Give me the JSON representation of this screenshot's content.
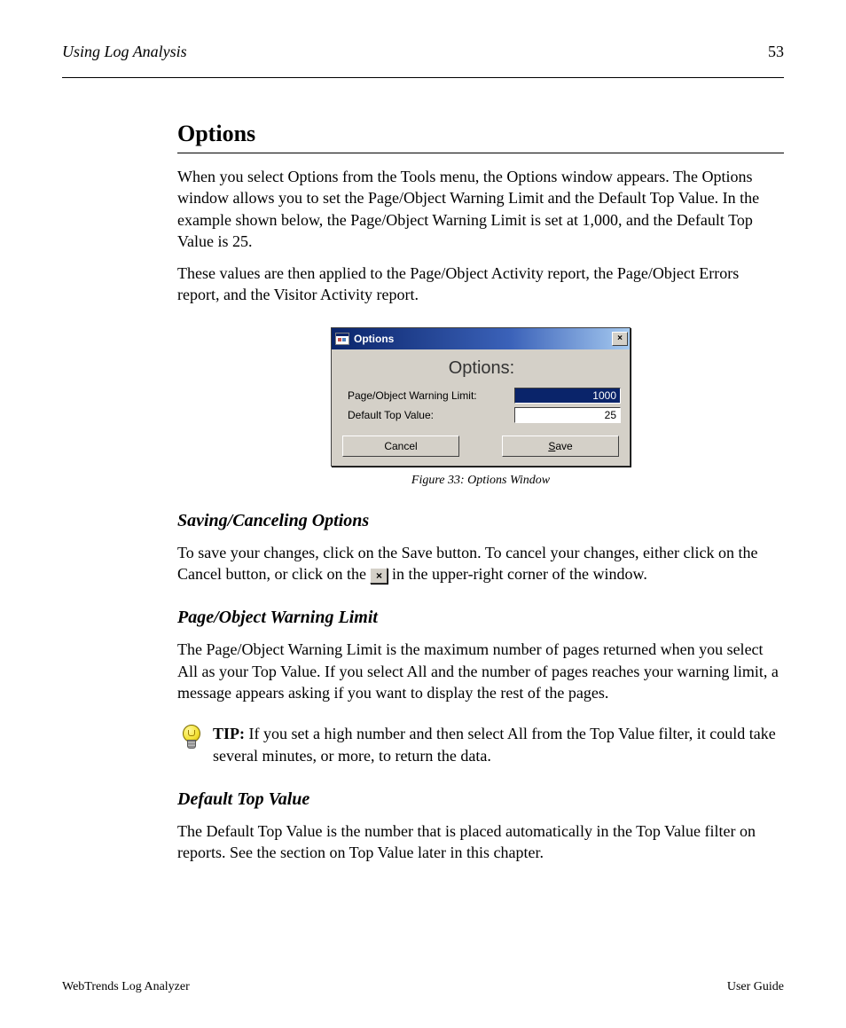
{
  "header": {
    "left": "Using Log Analysis",
    "right": "53"
  },
  "section": {
    "heading": "Options"
  },
  "intro": {
    "p1": "When you select Options from the Tools menu, the Options window appears. The Options window allows you to set the Page/Object Warning Limit and the Default Top Value. In the example shown below, the Page/Object Warning Limit is set at 1,000, and the Default Top Value is 25.",
    "p2": "These values are then applied to the Page/Object Activity report, the Page/Object Errors report, and the Visitor Activity report."
  },
  "dialog": {
    "title": "Options",
    "body_title": "Options:",
    "fields": {
      "warn_label": "Page/Object Warning Limit:",
      "warn_value": "1000",
      "top_label": "Default Top Value:",
      "top_value": "25"
    },
    "buttons": {
      "cancel": "Cancel",
      "save_pre": "S",
      "save_post": "ave"
    },
    "close_glyph": "×"
  },
  "figure_caption": "Figure 33: Options Window",
  "sub_save": {
    "heading": "Saving/Canceling Options",
    "p_before_icon": "To save your changes, click on the Save button. To cancel your changes, either click on the Cancel button, or click on the ",
    "p_after_icon": " in the upper-right corner of the window."
  },
  "sub_warn": {
    "heading": "Page/Object Warning Limit",
    "p1": "The Page/Object Warning Limit is the maximum number of pages returned when you select All as your Top Value. If you select All and the number of pages reaches your warning limit, a message appears asking if you want to display the rest of the pages.",
    "tip_label": "TIP:",
    "tip_body": " If you set a high number and then select All from the Top Value filter, it could take several minutes, or more, to return the data."
  },
  "sub_top": {
    "heading": "Default Top Value",
    "p1": "The Default Top Value is the number that is placed automatically in the Top Value filter on reports. See the section on Top Value later in this chapter."
  },
  "footer": {
    "left": "WebTrends Log Analyzer",
    "right": "User Guide"
  }
}
